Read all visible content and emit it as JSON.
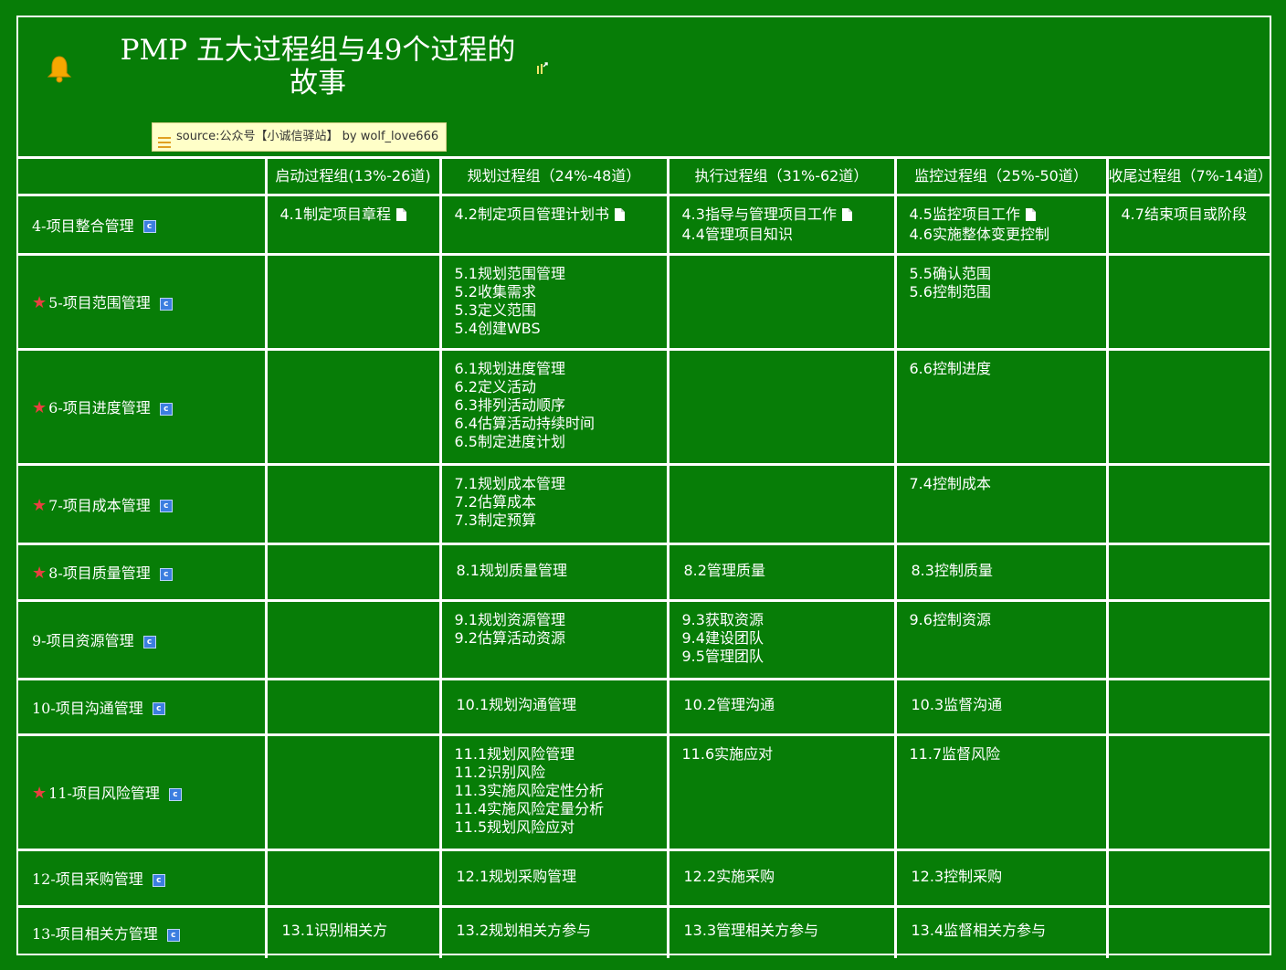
{
  "header": {
    "title_line1": "PMP 五大过程组与49个过程的",
    "title_line2": "故事",
    "source": "source:公众号【小诚信驿站】 by   wolf_love666"
  },
  "columns": [
    "启动过程组(13%-26道)",
    "规划过程组（24%-48道）",
    "执行过程组（31%-62道）",
    "监控过程组（25%-50道）",
    "收尾过程组（7%-14道）"
  ],
  "rows": [
    {
      "label": "4-项目整合管理",
      "starred": false,
      "initiating": [
        "4.1制定项目章程"
      ],
      "planning": [
        "4.2制定项目管理计划书"
      ],
      "executing": [
        "4.3指导与管理项目工作",
        "4.4管理项目知识"
      ],
      "monitoring": [
        "4.5监控项目工作",
        "4.6实施整体变更控制"
      ],
      "closing": [
        "4.7结束项目或阶段"
      ]
    },
    {
      "label": "5-项目范围管理",
      "starred": true,
      "initiating": [],
      "planning": [
        "5.1规划范围管理",
        "5.2收集需求",
        "5.3定义范围",
        "5.4创建WBS"
      ],
      "executing": [],
      "monitoring": [
        "5.5确认范围",
        "5.6控制范围"
      ],
      "closing": []
    },
    {
      "label": "6-项目进度管理",
      "starred": true,
      "initiating": [],
      "planning": [
        "6.1规划进度管理",
        "6.2定义活动",
        "6.3排列活动顺序",
        "6.4估算活动持续时间",
        "6.5制定进度计划"
      ],
      "executing": [],
      "monitoring": [
        "6.6控制进度"
      ],
      "closing": []
    },
    {
      "label": "7-项目成本管理",
      "starred": true,
      "initiating": [],
      "planning": [
        "7.1规划成本管理",
        "7.2估算成本",
        "7.3制定预算"
      ],
      "executing": [],
      "monitoring": [
        "7.4控制成本"
      ],
      "closing": []
    },
    {
      "label": "8-项目质量管理",
      "starred": true,
      "initiating": [],
      "planning": [
        "8.1规划质量管理"
      ],
      "executing": [
        "8.2管理质量"
      ],
      "monitoring": [
        "8.3控制质量"
      ],
      "closing": []
    },
    {
      "label": "9-项目资源管理",
      "starred": false,
      "initiating": [],
      "planning": [
        "9.1规划资源管理",
        "9.2估算活动资源"
      ],
      "executing": [
        "9.3获取资源",
        "9.4建设团队",
        "9.5管理团队"
      ],
      "monitoring": [
        "9.6控制资源"
      ],
      "closing": []
    },
    {
      "label": "10-项目沟通管理",
      "starred": false,
      "initiating": [],
      "planning": [
        "10.1规划沟通管理"
      ],
      "executing": [
        "10.2管理沟通"
      ],
      "monitoring": [
        "10.3监督沟通"
      ],
      "closing": []
    },
    {
      "label": "11-项目风险管理",
      "starred": true,
      "initiating": [],
      "planning": [
        "11.1规划风险管理",
        "11.2识别风险",
        "11.3实施风险定性分析",
        "11.4实施风险定量分析",
        "11.5规划风险应对"
      ],
      "executing": [
        "11.6实施应对"
      ],
      "monitoring": [
        "11.7监督风险"
      ],
      "closing": []
    },
    {
      "label": "12-项目采购管理",
      "starred": false,
      "initiating": [],
      "planning": [
        "12.1规划采购管理"
      ],
      "executing": [
        "12.2实施采购"
      ],
      "monitoring": [
        "12.3控制采购"
      ],
      "closing": []
    },
    {
      "label": "13-项目相关方管理",
      "starred": false,
      "initiating": [
        "13.1识别相关方"
      ],
      "planning": [
        "13.2规划相关方参与"
      ],
      "executing": [
        "13.3管理相关方参与"
      ],
      "monitoring": [
        "13.4监督相关方参与"
      ],
      "closing": []
    }
  ],
  "icons": {
    "bell": "bell-icon",
    "star": "star-icon",
    "topic_marker": "c-icon",
    "note": "note-icon",
    "expand": "expand-icon",
    "source_lines": "list-lines-icon"
  },
  "colors": {
    "background": "#077d07",
    "lines": "#ffffff",
    "star": "#e84040",
    "bell": "#f5a800",
    "note_bg": "#ffffc8",
    "c_icon": "#3c7ee0"
  }
}
